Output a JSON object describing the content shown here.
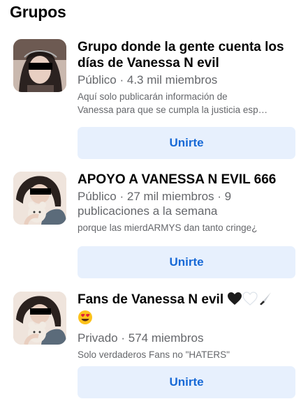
{
  "section": {
    "title": "Grupos"
  },
  "groups": [
    {
      "name": "Grupo donde la gente cuenta los días de Vanessa N evil",
      "meta": "Público · 4.3 mil miembros",
      "description_line1": "Aquí solo publicarán información de",
      "description_line2": "Vanessa para que se cumpla la justicia esp…",
      "button": "Unirte"
    },
    {
      "name": "APOYO A VANESSA N EVIL 666",
      "meta": "Público · 27 mil miembros · 9 publicaciones a la semana",
      "description": "porque las mierdARMYS dan tanto cringe¿",
      "button": "Unirte"
    },
    {
      "name": "Fans de Vanessa N evil",
      "name_emojis": [
        "black-heart-icon",
        "white-heart-icon",
        "knife-icon",
        "heart-eyes-face-icon"
      ],
      "meta": "Privado · 574 miembros",
      "description": "Solo verdaderos Fans no \"HATERS\"",
      "button": "Unirte"
    }
  ],
  "colors": {
    "button_bg": "#e7f0fd",
    "button_text": "#1769d6",
    "secondary_text": "#65676b"
  }
}
